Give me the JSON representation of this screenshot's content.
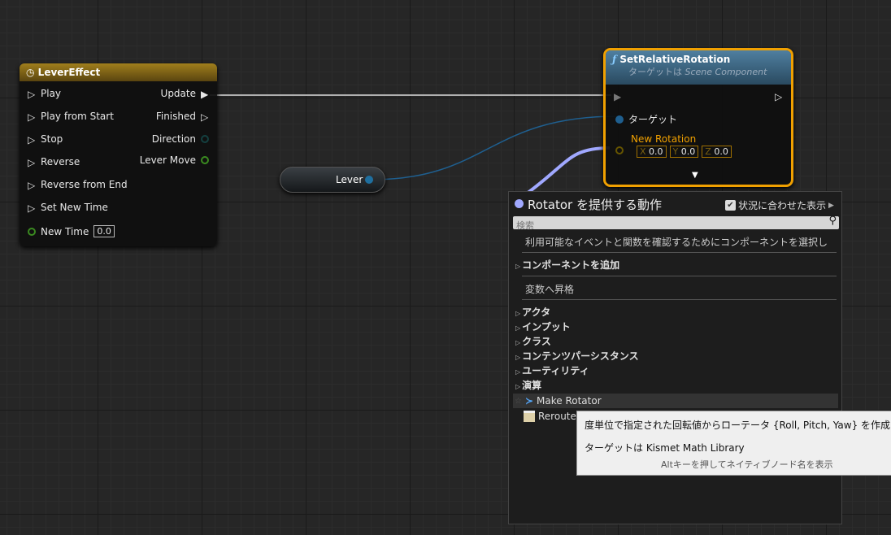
{
  "timeline_node": {
    "title": "LeverEffect",
    "inputs": [
      "Play",
      "Play from Start",
      "Stop",
      "Reverse",
      "Reverse from End",
      "Set New Time"
    ],
    "new_time_label": "New Time",
    "new_time_value": "0.0",
    "outputs": [
      "Update",
      "Finished",
      "Direction",
      "Lever Move"
    ]
  },
  "lever_node": {
    "label": "Lever"
  },
  "set_rotation_node": {
    "title": "SetRelativeRotation",
    "subtitle_prefix": "ターゲットは ",
    "subtitle_target": "Scene Component",
    "target_label": "ターゲット",
    "new_rotation_label": "New Rotation",
    "x_label": "X",
    "x": "0.0",
    "y_label": "Y",
    "y": "0.0",
    "z_label": "Z",
    "z": "0.0"
  },
  "action_menu": {
    "title": "Rotator を提供する動作",
    "context_label": "状況に合わせた表示",
    "context_checked": true,
    "search_placeholder": "検索",
    "hint": "利用可能なイベントと関数を確認するためにコンポーネントを選択し",
    "add_component": "コンポーネントを追加",
    "promote": "変数へ昇格",
    "categories": [
      "アクタ",
      "インプット",
      "クラス",
      "コンテンツパーシスタンス",
      "ユーティリティ",
      "演算"
    ],
    "items": [
      "Make Rotator",
      "Reroute"
    ]
  },
  "tooltip": {
    "description": "度単位で指定された回転値からローテータ {Roll, Pitch, Yaw} を作成します",
    "target": "ターゲットは Kismet Math Library",
    "hint": "Altキーを押してネイティブノード名を表示"
  },
  "colors": {
    "timeline_header": "#7a5f14",
    "function_header": "#3f6a88",
    "selection": "#f0a000",
    "rotator_pin": "#a0a8ff",
    "object_pin": "#1f6f9f",
    "float_pin": "#3a8a20"
  }
}
